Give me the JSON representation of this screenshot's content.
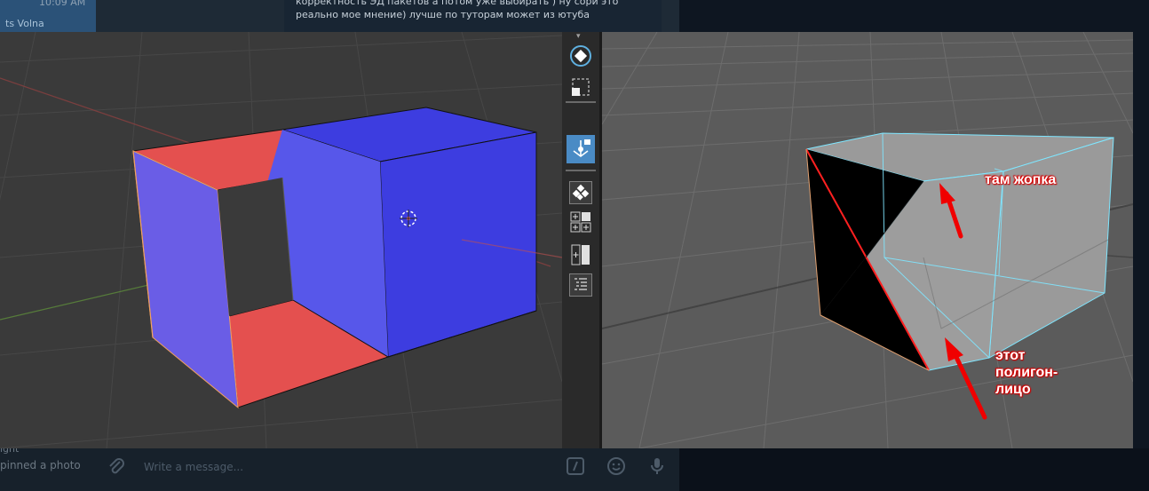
{
  "chat": {
    "timestamp": "10:09 AM",
    "sender_fragment": "ts Volna",
    "message_line1": "корректность ЭД пакетов а потом уже выбирать ) ну сори это",
    "message_line2": "реально мое мнение) лучше по туторам может из ютуба",
    "status_fragment": "ight",
    "pinned_label": "pinned a photo",
    "input_placeholder": "Write a message..."
  },
  "annotations": {
    "top": "там жопка",
    "bottom_line1": "этот",
    "bottom_line2": "полигон-",
    "bottom_line3": "лицо"
  },
  "colors": {
    "face_red": "#e4504f",
    "face_blue": "#3d3de0",
    "face_violet": "#6a5de6",
    "annotation_arrow": "#f00000",
    "wire_cyan": "#7fe6ff"
  },
  "icons": {
    "toolbar": [
      "rotate-tool-icon",
      "select-box-icon",
      "transform-gizmo-icon",
      "snap-icon",
      "grid-plus-icon",
      "split-view-icon",
      "outliner-icon"
    ],
    "composer": [
      "attach-icon",
      "commands-icon",
      "emoji-icon",
      "microphone-icon"
    ]
  }
}
